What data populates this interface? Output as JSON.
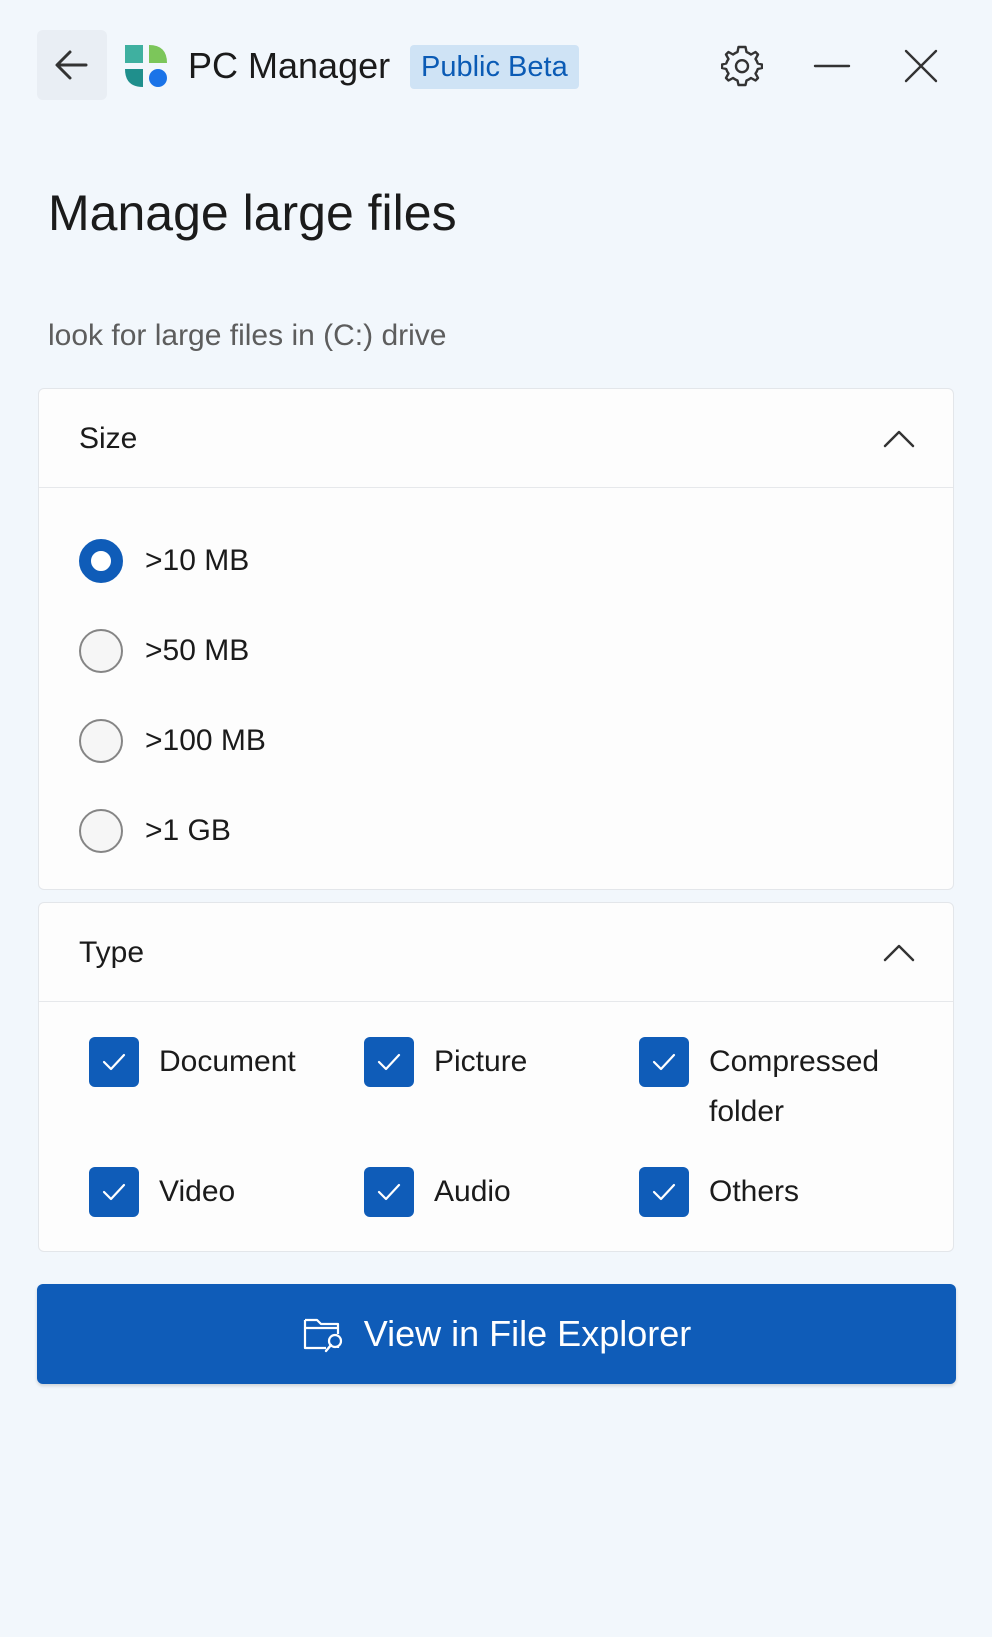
{
  "app": {
    "title": "PC Manager",
    "badge": "Public Beta"
  },
  "page": {
    "title": "Manage large files",
    "subtitle": "look for large files in (C:) drive"
  },
  "size_section": {
    "header": "Size",
    "selected_index": 0,
    "options": [
      ">10 MB",
      ">50 MB",
      ">100 MB",
      ">1 GB"
    ]
  },
  "type_section": {
    "header": "Type",
    "options": [
      {
        "label": "Document",
        "checked": true
      },
      {
        "label": "Picture",
        "checked": true
      },
      {
        "label": "Compressed folder",
        "checked": true
      },
      {
        "label": "Video",
        "checked": true
      },
      {
        "label": "Audio",
        "checked": true
      },
      {
        "label": "Others",
        "checked": true
      }
    ]
  },
  "action": {
    "label": "View in File Explorer",
    "icon": "folder-search-icon"
  },
  "colors": {
    "accent": "#0f5cb8",
    "background": "#f2f7fc",
    "badge_bg": "#cfe3f5"
  }
}
